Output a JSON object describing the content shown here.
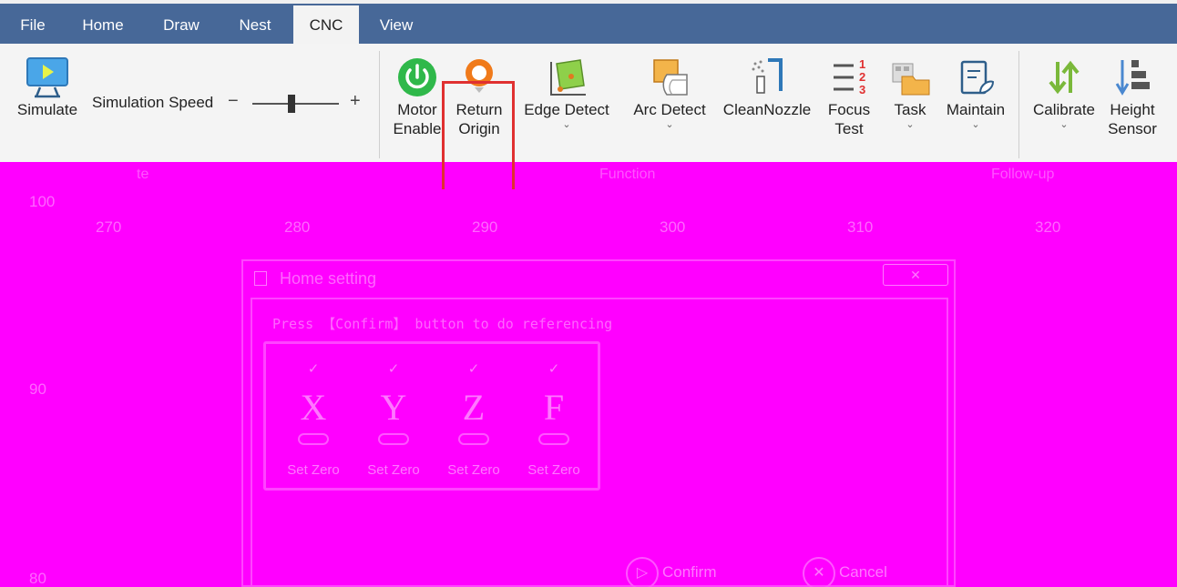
{
  "tabs": [
    "File",
    "Home",
    "Draw",
    "Nest",
    "CNC",
    "View"
  ],
  "active_tab": "CNC",
  "ribbon": {
    "simulate_label": "Simulate",
    "speed_label": "Simulation Speed",
    "speed_minus": "−",
    "speed_plus": "+",
    "speed_level": 0.45,
    "motor_enable": [
      "Motor",
      "Enable"
    ],
    "return_origin": [
      "Return",
      "Origin"
    ],
    "edge_detect": "Edge Detect",
    "arc_detect": "Arc Detect",
    "clean_nozzle": "CleanNozzle",
    "focus_test": [
      "Focus",
      "Test"
    ],
    "task": "Task",
    "maintain": "Maintain",
    "calibrate": "Calibrate",
    "height_sensor": [
      "Height",
      "Sensor"
    ],
    "chevron": "⌄"
  },
  "groups": {
    "simulate": "te",
    "function": "Function",
    "follow_up": "Follow-up"
  },
  "ruler": {
    "top": [
      "270",
      "280",
      "290",
      "300",
      "310",
      "320"
    ],
    "left": [
      "100",
      "90",
      "80"
    ]
  },
  "dialog": {
    "title": "Home setting",
    "close": "✕",
    "instruction": "Press 【Confirm】 button to do referencing",
    "axes": [
      {
        "check": "✓",
        "letter": "X",
        "zero": "Set Zero"
      },
      {
        "check": "✓",
        "letter": "Y",
        "zero": "Set Zero"
      },
      {
        "check": "✓",
        "letter": "Z",
        "zero": "Set Zero"
      },
      {
        "check": "✓",
        "letter": "F",
        "zero": "Set Zero"
      }
    ],
    "confirm": "Confirm",
    "cancel": "Cancel",
    "confirm_icon": "▷",
    "cancel_icon": "✕"
  },
  "colors": {
    "tabbar": "#476898",
    "ribbon": "#f4f4f4",
    "canvas": "#ff00ff",
    "highlight": "#e03030"
  }
}
